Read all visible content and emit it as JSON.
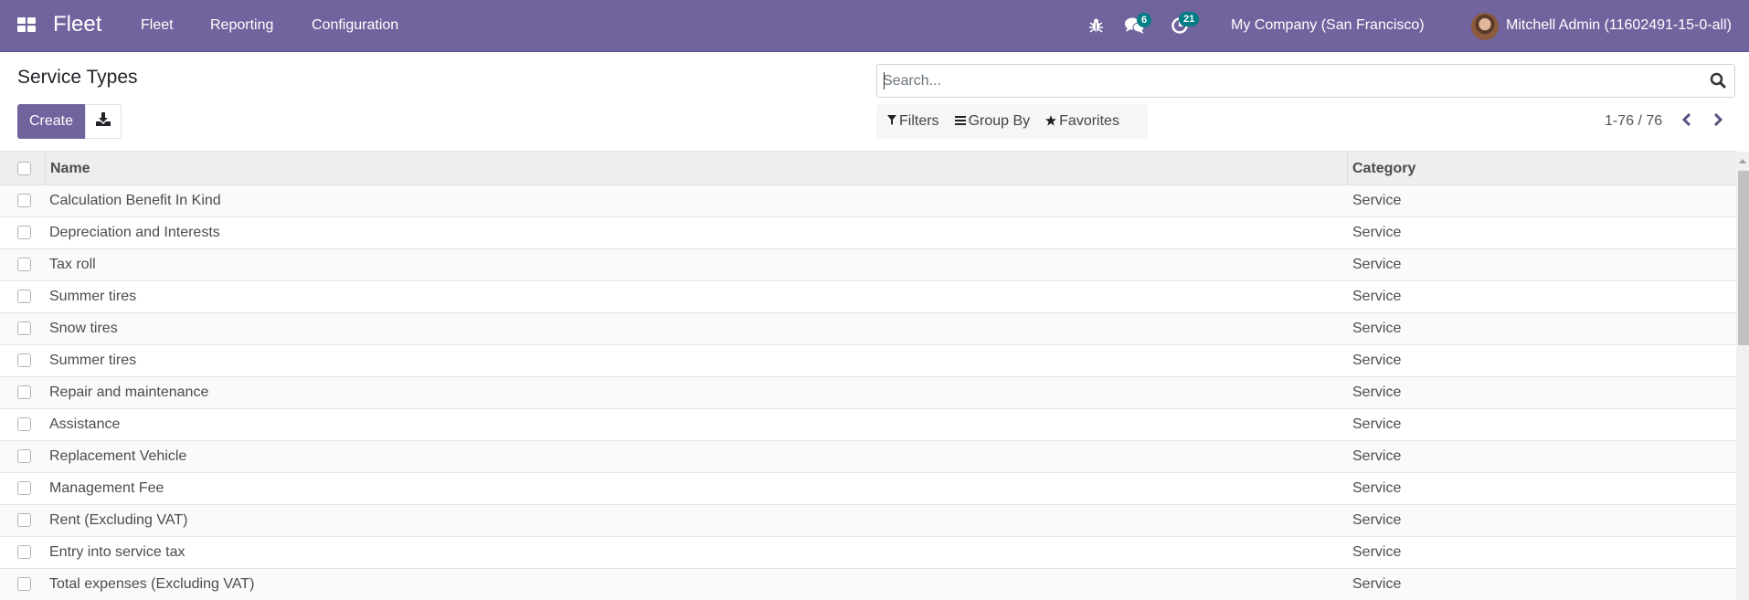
{
  "navbar": {
    "brand": "Fleet",
    "menu": [
      "Fleet",
      "Reporting",
      "Configuration"
    ],
    "icons": {
      "apps": "apps-grid-icon",
      "debug": "bug-icon",
      "messages": "chat-icon",
      "activities": "clock-icon"
    },
    "messages_count": "6",
    "activities_count": "21",
    "company": "My Company (San Francisco)",
    "user": "Mitchell Admin (11602491-15-0-all)"
  },
  "control_panel": {
    "title": "Service Types",
    "create_label": "Create",
    "download_icon": "download-icon",
    "search_placeholder": "Search...",
    "search_value": "",
    "filters_label": "Filters",
    "group_by_label": "Group By",
    "favorites_label": "Favorites",
    "pager": "1-76 / 76"
  },
  "table": {
    "columns": [
      "Name",
      "Category"
    ],
    "rows": [
      {
        "name": "Calculation Benefit In Kind",
        "category": "Service"
      },
      {
        "name": "Depreciation and Interests",
        "category": "Service"
      },
      {
        "name": "Tax roll",
        "category": "Service"
      },
      {
        "name": "Summer tires",
        "category": "Service"
      },
      {
        "name": "Snow tires",
        "category": "Service"
      },
      {
        "name": "Summer tires",
        "category": "Service"
      },
      {
        "name": "Repair and maintenance",
        "category": "Service"
      },
      {
        "name": "Assistance",
        "category": "Service"
      },
      {
        "name": "Replacement Vehicle",
        "category": "Service"
      },
      {
        "name": "Management Fee",
        "category": "Service"
      },
      {
        "name": "Rent (Excluding VAT)",
        "category": "Service"
      },
      {
        "name": "Entry into service tax",
        "category": "Service"
      },
      {
        "name": "Total expenses (Excluding VAT)",
        "category": "Service"
      }
    ]
  },
  "colors": {
    "brand": "#71639e",
    "badge": "#017e84"
  }
}
